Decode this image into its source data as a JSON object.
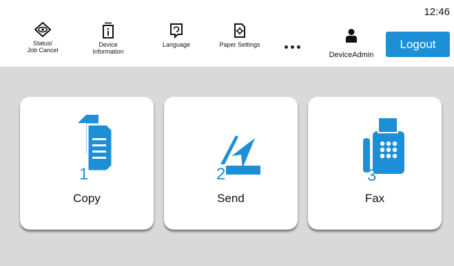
{
  "header": {
    "clock": "12:46",
    "tools": [
      {
        "label": "Status/\nJob Cancel",
        "icon": "status-eye-icon"
      },
      {
        "label": "Device\nInformation",
        "icon": "device-info-icon"
      },
      {
        "label": "Language",
        "icon": "language-icon"
      },
      {
        "label": "Paper Settings",
        "icon": "paper-settings-icon"
      }
    ],
    "more_icon": "more-dots-icon",
    "user": {
      "name": "DeviceAdmin",
      "icon": "user-icon"
    },
    "logout_label": "Logout"
  },
  "functions": [
    {
      "label": "Copy",
      "number": "1",
      "icon": "copy-icon"
    },
    {
      "label": "Send",
      "number": "2",
      "icon": "send-icon"
    },
    {
      "label": "Fax",
      "number": "3",
      "icon": "fax-icon"
    }
  ],
  "colors": {
    "accent": "#1d8fd6",
    "background": "#d9d9d9",
    "card": "#ffffff"
  }
}
